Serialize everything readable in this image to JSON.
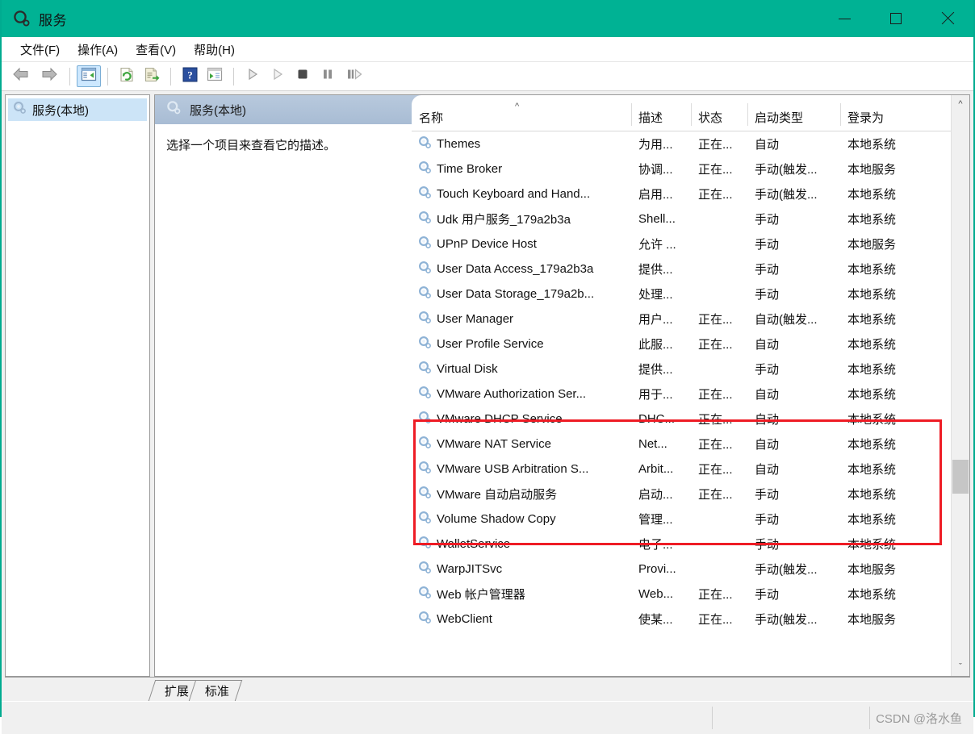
{
  "window": {
    "title": "服务",
    "icon": "services-gear-icon",
    "accent_color": "#00b294",
    "controls": {
      "minimize": "minimize-icon",
      "maximize": "maximize-icon",
      "close": "close-icon"
    }
  },
  "menubar": {
    "items": [
      {
        "label": "文件(F)",
        "name": "menu-file"
      },
      {
        "label": "操作(A)",
        "name": "menu-action"
      },
      {
        "label": "查看(V)",
        "name": "menu-view"
      },
      {
        "label": "帮助(H)",
        "name": "menu-help"
      }
    ]
  },
  "toolbar": {
    "buttons": [
      {
        "name": "back-arrow-icon",
        "group": 0
      },
      {
        "name": "forward-arrow-icon",
        "group": 0
      },
      {
        "name": "show-hide-console-tree-icon",
        "group": 1,
        "active": true
      },
      {
        "name": "refresh-icon",
        "group": 2
      },
      {
        "name": "export-list-icon",
        "group": 2
      },
      {
        "name": "help-icon",
        "group": 3
      },
      {
        "name": "show-action-pane-icon",
        "group": 3
      },
      {
        "name": "start-service-icon",
        "group": 4
      },
      {
        "name": "resume-service-icon",
        "group": 4
      },
      {
        "name": "stop-service-icon",
        "group": 4
      },
      {
        "name": "pause-service-icon",
        "group": 4
      },
      {
        "name": "restart-service-icon",
        "group": 4
      }
    ]
  },
  "sidebar": {
    "items": [
      {
        "label": "服务(本地)",
        "icon": "services-gear-icon",
        "selected": true
      }
    ]
  },
  "detail_pane": {
    "banner_title": "服务(本地)",
    "description": "选择一个项目来查看它的描述。"
  },
  "list": {
    "columns": [
      {
        "key": "name",
        "label": "名称",
        "sorted": "asc",
        "sort_glyph": "^"
      },
      {
        "key": "desc",
        "label": "描述"
      },
      {
        "key": "state",
        "label": "状态"
      },
      {
        "key": "start",
        "label": "启动类型"
      },
      {
        "key": "logon",
        "label": "登录为"
      }
    ],
    "rows": [
      {
        "name": "Themes",
        "desc": "为用...",
        "state": "正在...",
        "start": "自动",
        "logon": "本地系统"
      },
      {
        "name": "Time Broker",
        "desc": "协调...",
        "state": "正在...",
        "start": "手动(触发...",
        "logon": "本地服务"
      },
      {
        "name": "Touch Keyboard and Hand...",
        "desc": "启用...",
        "state": "正在...",
        "start": "手动(触发...",
        "logon": "本地系统"
      },
      {
        "name": "Udk 用户服务_179a2b3a",
        "desc": "Shell...",
        "state": "",
        "start": "手动",
        "logon": "本地系统"
      },
      {
        "name": "UPnP Device Host",
        "desc": "允许 ...",
        "state": "",
        "start": "手动",
        "logon": "本地服务"
      },
      {
        "name": "User Data Access_179a2b3a",
        "desc": "提供...",
        "state": "",
        "start": "手动",
        "logon": "本地系统"
      },
      {
        "name": "User Data Storage_179a2b...",
        "desc": "处理...",
        "state": "",
        "start": "手动",
        "logon": "本地系统"
      },
      {
        "name": "User Manager",
        "desc": "用户...",
        "state": "正在...",
        "start": "自动(触发...",
        "logon": "本地系统"
      },
      {
        "name": "User Profile Service",
        "desc": "此服...",
        "state": "正在...",
        "start": "自动",
        "logon": "本地系统"
      },
      {
        "name": "Virtual Disk",
        "desc": "提供...",
        "state": "",
        "start": "手动",
        "logon": "本地系统"
      },
      {
        "name": "VMware Authorization Ser...",
        "desc": "用于...",
        "state": "正在...",
        "start": "自动",
        "logon": "本地系统"
      },
      {
        "name": "VMware DHCP Service",
        "desc": "DHC...",
        "state": "正在...",
        "start": "自动",
        "logon": "本地系统"
      },
      {
        "name": "VMware NAT Service",
        "desc": "Net...",
        "state": "正在...",
        "start": "自动",
        "logon": "本地系统"
      },
      {
        "name": "VMware USB Arbitration S...",
        "desc": "Arbit...",
        "state": "正在...",
        "start": "自动",
        "logon": "本地系统"
      },
      {
        "name": "VMware 自动启动服务",
        "desc": "启动...",
        "state": "正在...",
        "start": "手动",
        "logon": "本地系统"
      },
      {
        "name": "Volume Shadow Copy",
        "desc": "管理...",
        "state": "",
        "start": "手动",
        "logon": "本地系统"
      },
      {
        "name": "WalletService",
        "desc": "电子...",
        "state": "",
        "start": "手动",
        "logon": "本地系统"
      },
      {
        "name": "WarpJITSvc",
        "desc": "Provi...",
        "state": "",
        "start": "手动(触发...",
        "logon": "本地服务"
      },
      {
        "name": "Web 帐户管理器",
        "desc": "Web...",
        "state": "正在...",
        "start": "手动",
        "logon": "本地系统"
      },
      {
        "name": "WebClient",
        "desc": "使某...",
        "state": "正在...",
        "start": "手动(触发...",
        "logon": "本地服务"
      }
    ]
  },
  "annotation": {
    "color": "#ee1c25",
    "highlighted_rows": [
      "VMware Authorization Ser...",
      "VMware DHCP Service",
      "VMware NAT Service",
      "VMware USB Arbitration S...",
      "VMware 自动启动服务"
    ]
  },
  "scrollbar": {
    "up_arrow": "^",
    "down_arrow": "ˇ"
  },
  "tabs": [
    {
      "label": "扩展",
      "name": "tab-extended",
      "active": false
    },
    {
      "label": "标准",
      "name": "tab-standard",
      "active": false
    }
  ],
  "statusbar": {
    "watermark": "CSDN @洛水鱼"
  }
}
